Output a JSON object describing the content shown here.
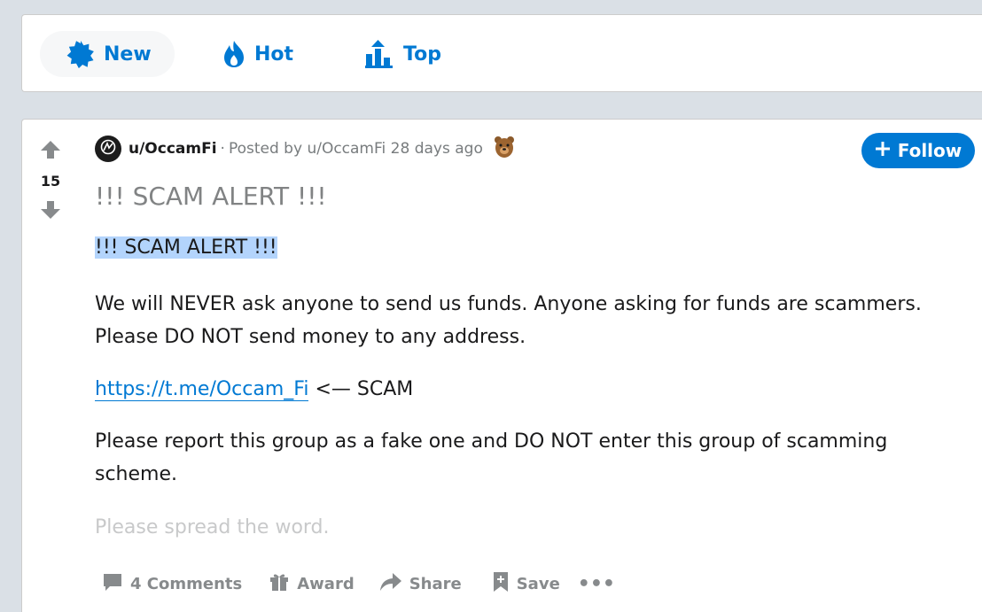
{
  "sort": {
    "new_label": "New",
    "hot_label": "Hot",
    "top_label": "Top"
  },
  "post": {
    "score": "15",
    "author": "u/OccamFi",
    "separator": "·",
    "posted_by_prefix": "Posted by",
    "posted_by_user": "u/OccamFi",
    "age": "28 days ago",
    "follow_label": "Follow",
    "title": "!!! SCAM ALERT !!!",
    "body": {
      "p1": "!!! SCAM ALERT !!!",
      "p2": "We will NEVER ask anyone to send us funds. Anyone asking for funds are scammers. Please DO NOT send money to any address.",
      "link": "https://t.me/Occam_Fi",
      "link_suffix": " <— SCAM",
      "p4": "Please report this group as a fake one and DO NOT enter this group of scamming scheme.",
      "p5": "Please spread the word."
    }
  },
  "actions": {
    "comments": "4 Comments",
    "award": "Award",
    "share": "Share",
    "save": "Save",
    "more": "•••"
  },
  "colors": {
    "accent": "#0079d3",
    "page_bg": "#dae0e6",
    "muted": "#878a8c"
  }
}
